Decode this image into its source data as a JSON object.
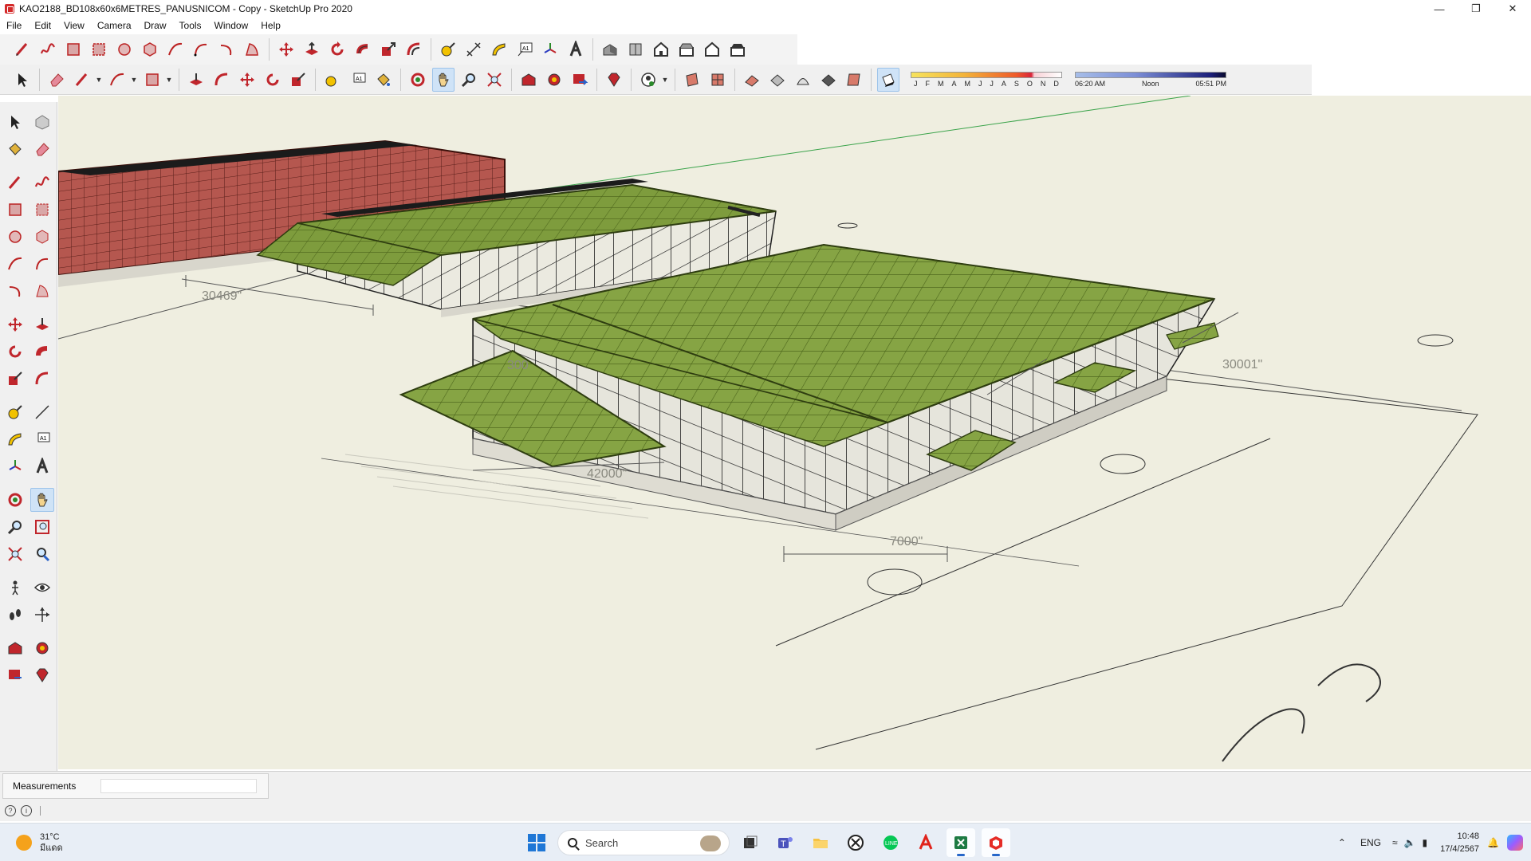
{
  "window": {
    "title": "KAO2188_BD108x60x6METRES_PANUSNICOM - Copy - SketchUp Pro 2020",
    "controls": [
      "minimize-icon",
      "restore-icon",
      "close-icon"
    ]
  },
  "menu": [
    "File",
    "Edit",
    "View",
    "Camera",
    "Draw",
    "Tools",
    "Window",
    "Help"
  ],
  "shadow": {
    "months": [
      "J",
      "F",
      "M",
      "A",
      "M",
      "J",
      "J",
      "A",
      "S",
      "O",
      "N",
      "D"
    ],
    "time_start": "06:20 AM",
    "time_mid": "Noon",
    "time_end": "05:51 PM"
  },
  "viewport": {
    "dimensions": [
      "30469\"",
      "30001\"",
      "42000\"",
      "7000\"",
      "300"
    ],
    "colors": {
      "background": "#efeee0",
      "roof": "#7a9a3a",
      "roof_dark": "#4f6a1c",
      "brick": "#b5574f",
      "frame": "#222222"
    }
  },
  "measurements": {
    "label": "Measurements",
    "value": ""
  },
  "taskbar": {
    "weather_temp": "31°C",
    "weather_desc": "มีแดด",
    "search_placeholder": "Search",
    "language": "ENG",
    "time": "10:48",
    "date": "17/4/2567"
  }
}
